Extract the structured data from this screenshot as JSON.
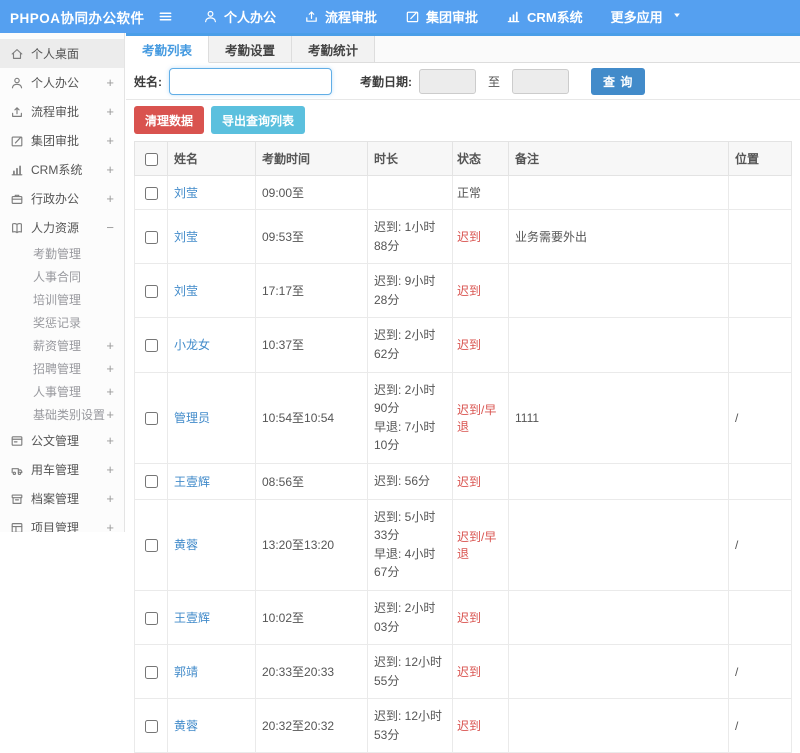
{
  "colors": {
    "navbar": "#55a0f0",
    "accent": "#428bca",
    "tab_active": "#459ae0",
    "danger": "#d9534f",
    "info": "#5bc0de",
    "late": "#d9534f",
    "link": "#428bca"
  },
  "topbar": {
    "logo": "PHPOA协同办公软件",
    "items": [
      {
        "label": "个人办公",
        "icon": "user-icon"
      },
      {
        "label": "流程审批",
        "icon": "flow-icon"
      },
      {
        "label": "集团审批",
        "icon": "edit-icon"
      },
      {
        "label": "CRM系统",
        "icon": "chart-icon"
      },
      {
        "label": "更多应用",
        "icon": "",
        "caret": true
      }
    ]
  },
  "sidebar": {
    "items": [
      {
        "label": "个人桌面",
        "icon": "home-icon",
        "active": true,
        "expand": ""
      },
      {
        "label": "个人办公",
        "icon": "user-icon",
        "expand": "+"
      },
      {
        "label": "流程审批",
        "icon": "flow-icon",
        "expand": "+"
      },
      {
        "label": "集团审批",
        "icon": "edit-icon",
        "expand": "+"
      },
      {
        "label": "CRM系统",
        "icon": "chart-icon",
        "expand": "+"
      },
      {
        "label": "行政办公",
        "icon": "briefcase-icon",
        "expand": "+"
      },
      {
        "label": "人力资源",
        "icon": "book-icon",
        "expand": "−"
      },
      {
        "label": "考勤管理",
        "sub": true,
        "expand": ""
      },
      {
        "label": "人事合同",
        "sub": true,
        "expand": ""
      },
      {
        "label": "培训管理",
        "sub": true,
        "expand": ""
      },
      {
        "label": "奖惩记录",
        "sub": true,
        "expand": ""
      },
      {
        "label": "薪资管理",
        "sub": true,
        "expand": "+"
      },
      {
        "label": "招聘管理",
        "sub": true,
        "expand": "+"
      },
      {
        "label": "人事管理",
        "sub": true,
        "expand": "+"
      },
      {
        "label": "基础类别设置",
        "sub": true,
        "expand": "+"
      },
      {
        "label": "公文管理",
        "icon": "doc-icon",
        "expand": "+"
      },
      {
        "label": "用车管理",
        "icon": "car-icon",
        "expand": "+"
      },
      {
        "label": "档案管理",
        "icon": "archive-icon",
        "expand": "+"
      },
      {
        "label": "项目管理",
        "icon": "project-icon",
        "expand": "+"
      }
    ]
  },
  "tabs": [
    {
      "label": "考勤列表",
      "active": true
    },
    {
      "label": "考勤设置",
      "active": false
    },
    {
      "label": "考勤统计",
      "active": false
    }
  ],
  "filter": {
    "name_label": "姓名:",
    "name_value": "",
    "date_label": "考勤日期:",
    "date_from": "",
    "to_label": "至",
    "date_to": "",
    "search_button": "查 询"
  },
  "actions": {
    "clean_button": "清理数据",
    "export_button": "导出查询列表"
  },
  "table": {
    "headers": [
      "姓名",
      "考勤时间",
      "时长",
      "状态",
      "备注",
      "位置"
    ],
    "rows": [
      {
        "name": "刘莹",
        "time": "09:00至",
        "duration_lines": [],
        "status": "正常",
        "status_type": "normal",
        "note": "",
        "location": ""
      },
      {
        "name": "刘莹",
        "time": "09:53至",
        "duration_lines": [
          "迟到: 1小时88分"
        ],
        "status": "迟到",
        "status_type": "late",
        "note": "业务需要外出",
        "location": ""
      },
      {
        "name": "刘莹",
        "time": "17:17至",
        "duration_lines": [
          "迟到: 9小时28分"
        ],
        "status": "迟到",
        "status_type": "late",
        "note": "",
        "location": ""
      },
      {
        "name": "小龙女",
        "time": "10:37至",
        "duration_lines": [
          "迟到: 2小时62分"
        ],
        "status": "迟到",
        "status_type": "late",
        "note": "",
        "location": ""
      },
      {
        "name": "管理员",
        "time": "10:54至10:54",
        "duration_lines": [
          "迟到: 2小时90分",
          "早退: 7小时10分"
        ],
        "status": "迟到/早退",
        "status_type": "late",
        "note": "1111",
        "location": "/"
      },
      {
        "name": "王壹辉",
        "time": "08:56至",
        "duration_lines": [
          "迟到: 56分"
        ],
        "status": "迟到",
        "status_type": "late",
        "note": "",
        "location": ""
      },
      {
        "name": "黄蓉",
        "time": "13:20至13:20",
        "duration_lines": [
          "迟到: 5小时33分",
          "早退: 4小时67分"
        ],
        "status": "迟到/早退",
        "status_type": "late",
        "note": "",
        "location": "/"
      },
      {
        "name": "王壹辉",
        "time": "10:02至",
        "duration_lines": [
          "迟到: 2小时03分"
        ],
        "status": "迟到",
        "status_type": "late",
        "note": "",
        "location": ""
      },
      {
        "name": "郭靖",
        "time": "20:33至20:33",
        "duration_lines": [
          "迟到: 12小时55分"
        ],
        "status": "迟到",
        "status_type": "late",
        "note": "",
        "location": "/"
      },
      {
        "name": "黄蓉",
        "time": "20:32至20:32",
        "duration_lines": [
          "迟到: 12小时53分"
        ],
        "status": "迟到",
        "status_type": "late",
        "note": "",
        "location": "/"
      }
    ]
  }
}
